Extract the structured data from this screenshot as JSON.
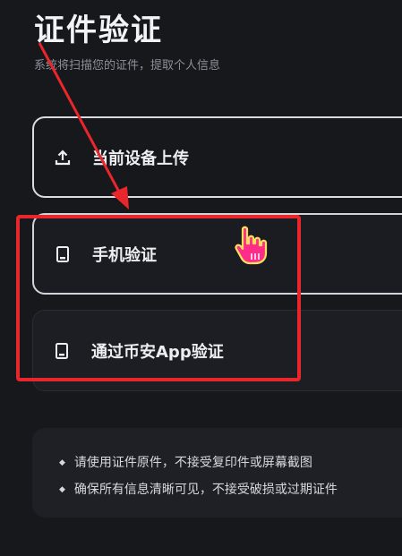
{
  "header": {
    "title": "证件验证",
    "subtitle": "系统将扫描您的证件，提取个人信息"
  },
  "options": [
    {
      "label": "当前设备上传",
      "icon": "upload-icon"
    },
    {
      "label": "手机验证",
      "icon": "phone-icon"
    },
    {
      "label": "通过币安App验证",
      "icon": "phone-icon"
    }
  ],
  "notes": [
    "请使用证件原件，不接受复印件或屏幕截图",
    "确保所有信息清晰可见，不接受破损或过期证件"
  ],
  "annotation": {
    "highlight_color": "#e8262b",
    "cursor_icon": "hand-pointer-icon"
  }
}
